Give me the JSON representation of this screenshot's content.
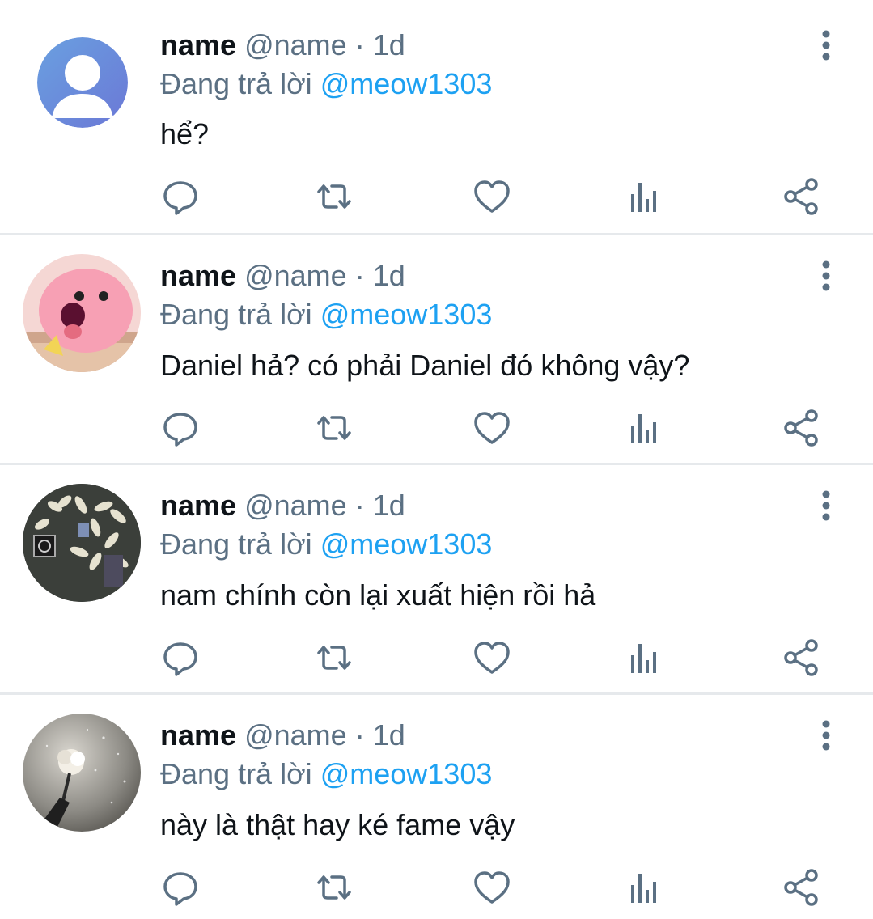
{
  "tweets": [
    {
      "name": "name",
      "handle": "@name",
      "separator": "·",
      "time": "1d",
      "reply_prefix": "Đang trả lời",
      "reply_to": "@meow1303",
      "text": "hể?",
      "avatar": "default-avatar-icon"
    },
    {
      "name": "name",
      "handle": "@name",
      "separator": "·",
      "time": "1d",
      "reply_prefix": "Đang trả lời",
      "reply_to": "@meow1303",
      "text": "Daniel hả? có phải Daniel đó không vậy?",
      "avatar": "pink-character-avatar"
    },
    {
      "name": "name",
      "handle": "@name",
      "separator": "·",
      "time": "1d",
      "reply_prefix": "Đang trả lời",
      "reply_to": "@meow1303",
      "text": "nam chính còn lại xuất hiện rồi hả",
      "avatar": "flowers-photo-avatar"
    },
    {
      "name": "name",
      "handle": "@name",
      "separator": "·",
      "time": "1d",
      "reply_prefix": "Đang trả lời",
      "reply_to": "@meow1303",
      "text": "này là thật hay ké fame vậy",
      "avatar": "rose-photo-avatar"
    }
  ],
  "icons": {
    "reply": "reply-icon",
    "retweet": "retweet-icon",
    "like": "heart-icon",
    "analytics": "analytics-icon",
    "share": "share-icon",
    "more": "more-vertical-icon"
  },
  "colors": {
    "text": "#0f1419",
    "secondary": "#5b7083",
    "accent": "#1da1f2",
    "divider": "#e6e9ec"
  }
}
